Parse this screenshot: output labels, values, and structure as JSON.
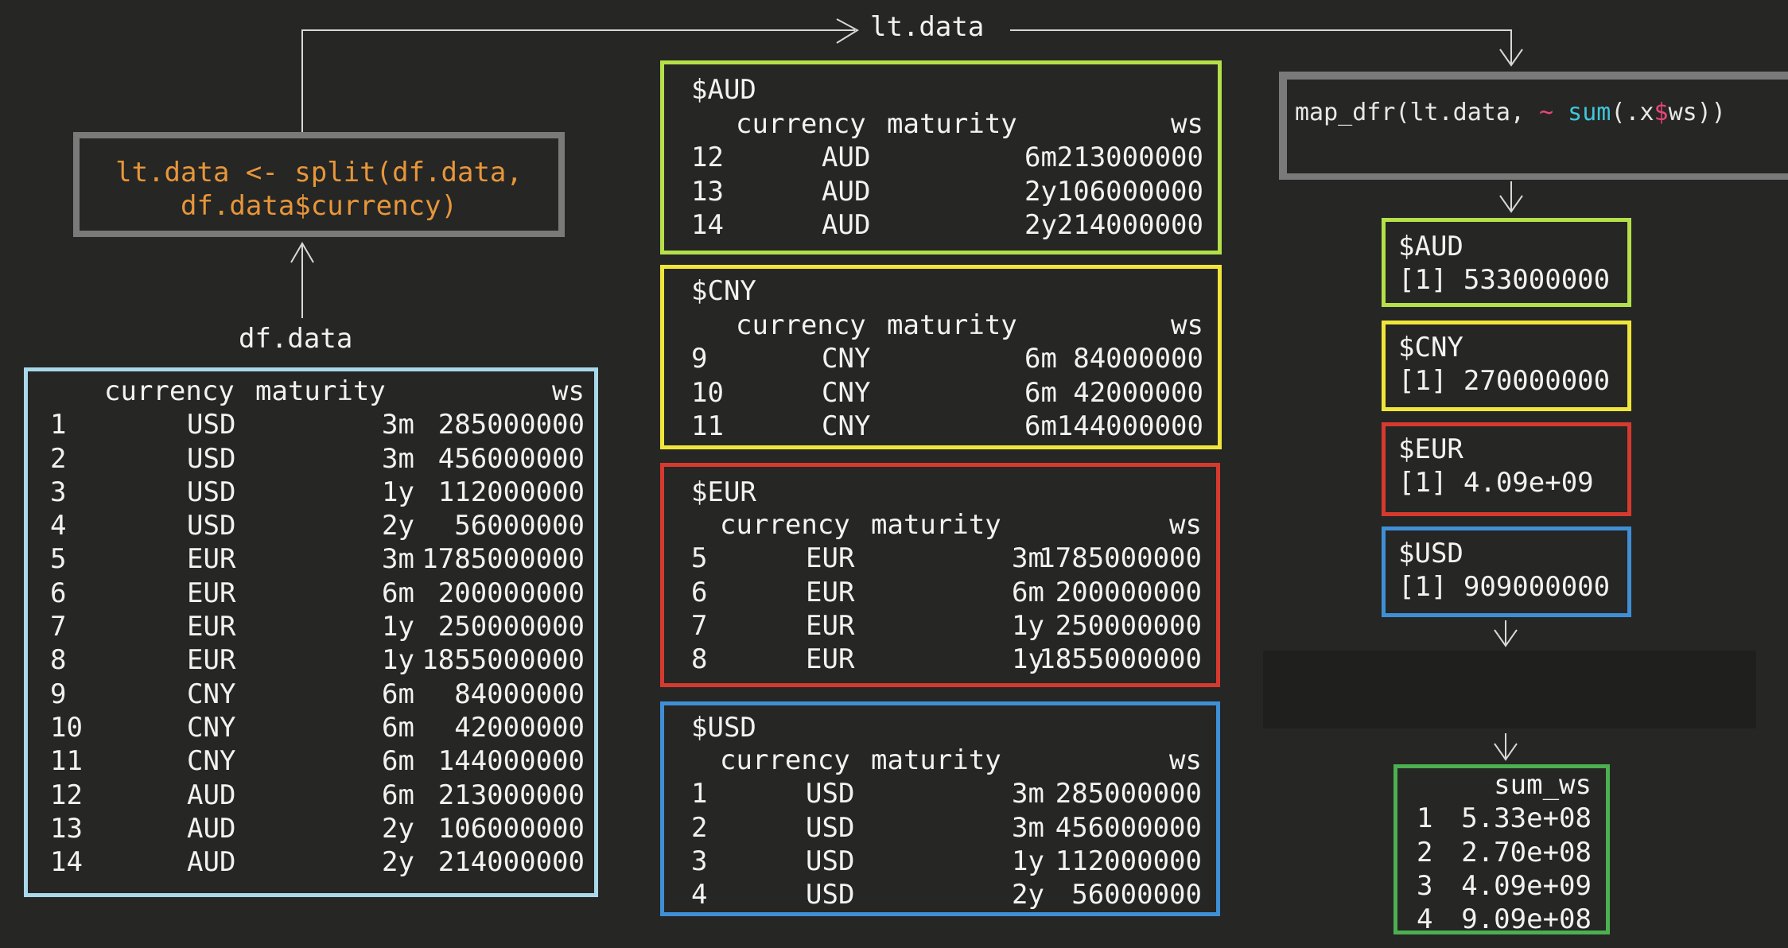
{
  "colors": {
    "background": "#262624",
    "df_border": "#a8d8ea",
    "aud_border": "#b5e04a",
    "cny_border": "#f0e63a",
    "eur_border": "#d63a2f",
    "usd_border": "#3f8fd6",
    "sum_border": "#4caf50",
    "code_border": "#7a7a7a",
    "code_text": "#e8963a"
  },
  "split_code": {
    "line1": "lt.data <- split(df.data,",
    "line2": "df.data$currency)"
  },
  "map_code": {
    "prefix": "map_dfr(lt.data, ",
    "tilde": "~",
    "fn": "sum",
    "arg_open": "(.x",
    "dollar": "$",
    "arg_close": "ws))"
  },
  "labels": {
    "lt_data": "lt.data",
    "df_data": "df.data"
  },
  "df_table": {
    "headers": [
      "currency",
      "maturity",
      "ws"
    ],
    "rows": [
      [
        "1",
        "USD",
        "3m",
        "285000000"
      ],
      [
        "2",
        "USD",
        "3m",
        "456000000"
      ],
      [
        "3",
        "USD",
        "1y",
        "112000000"
      ],
      [
        "4",
        "USD",
        "2y",
        "56000000"
      ],
      [
        "5",
        "EUR",
        "3m",
        "1785000000"
      ],
      [
        "6",
        "EUR",
        "6m",
        "200000000"
      ],
      [
        "7",
        "EUR",
        "1y",
        "250000000"
      ],
      [
        "8",
        "EUR",
        "1y",
        "1855000000"
      ],
      [
        "9",
        "CNY",
        "6m",
        "84000000"
      ],
      [
        "10",
        "CNY",
        "6m",
        "42000000"
      ],
      [
        "11",
        "CNY",
        "6m",
        "144000000"
      ],
      [
        "12",
        "AUD",
        "6m",
        "213000000"
      ],
      [
        "13",
        "AUD",
        "2y",
        "106000000"
      ],
      [
        "14",
        "AUD",
        "2y",
        "214000000"
      ]
    ]
  },
  "groups": [
    {
      "title": "$AUD",
      "headers": [
        "currency",
        "maturity",
        "ws"
      ],
      "rows": [
        [
          "12",
          "AUD",
          "6m",
          "213000000"
        ],
        [
          "13",
          "AUD",
          "2y",
          "106000000"
        ],
        [
          "14",
          "AUD",
          "2y",
          "214000000"
        ]
      ]
    },
    {
      "title": "$CNY",
      "headers": [
        "currency",
        "maturity",
        "ws"
      ],
      "rows": [
        [
          "9",
          "CNY",
          "6m",
          "84000000"
        ],
        [
          "10",
          "CNY",
          "6m",
          "42000000"
        ],
        [
          "11",
          "CNY",
          "6m",
          "144000000"
        ]
      ]
    },
    {
      "title": "$EUR",
      "headers": [
        "currency",
        "maturity",
        "ws"
      ],
      "rows": [
        [
          "5",
          "EUR",
          "3m",
          "1785000000"
        ],
        [
          "6",
          "EUR",
          "6m",
          "200000000"
        ],
        [
          "7",
          "EUR",
          "1y",
          "250000000"
        ],
        [
          "8",
          "EUR",
          "1y",
          "1855000000"
        ]
      ]
    },
    {
      "title": "$USD",
      "headers": [
        "currency",
        "maturity",
        "ws"
      ],
      "rows": [
        [
          "1",
          "USD",
          "3m",
          "285000000"
        ],
        [
          "2",
          "USD",
          "3m",
          "456000000"
        ],
        [
          "3",
          "USD",
          "1y",
          "112000000"
        ],
        [
          "4",
          "USD",
          "2y",
          "56000000"
        ]
      ]
    }
  ],
  "sums": [
    {
      "title": "$AUD",
      "value": "[1] 533000000"
    },
    {
      "title": "$CNY",
      "value": "[1] 270000000"
    },
    {
      "title": "$EUR",
      "value": "[1] 4.09e+09"
    },
    {
      "title": "$USD",
      "value": "[1] 909000000"
    }
  ],
  "sum_table": {
    "header": "sum_ws",
    "rows": [
      [
        "1",
        "5.33e+08"
      ],
      [
        "2",
        "2.70e+08"
      ],
      [
        "3",
        "4.09e+09"
      ],
      [
        "4",
        "9.09e+08"
      ]
    ]
  }
}
